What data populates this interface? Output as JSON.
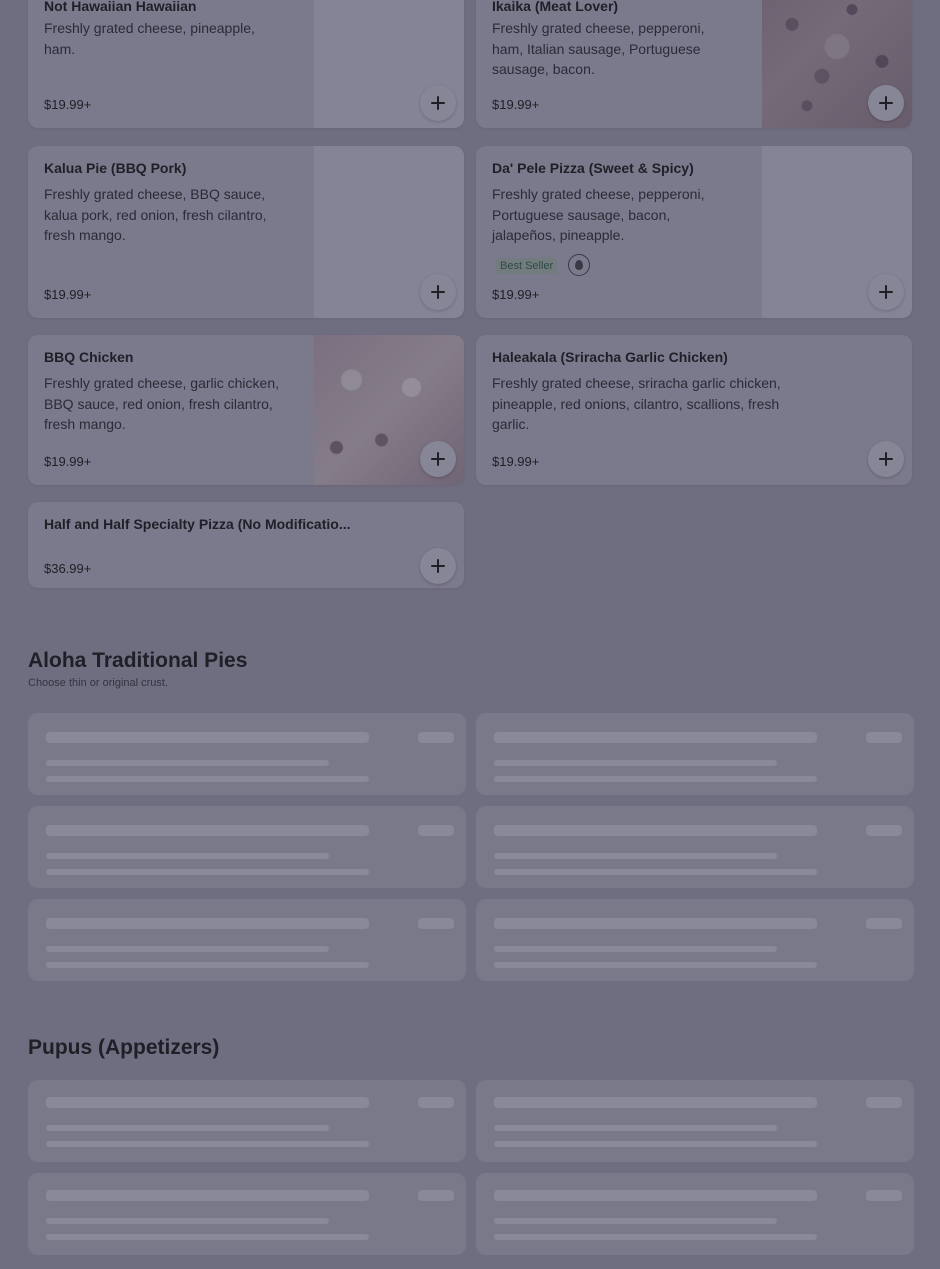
{
  "colors": {
    "overlay": "#6f6e80",
    "card": "#7b7a8c",
    "text": "#1f1f27",
    "badge_text": "#2f4a44"
  },
  "items": [
    {
      "name": "Not Hawaiian Hawaiian",
      "desc": "Freshly grated cheese, pineapple, ham.",
      "price": "$19.99+"
    },
    {
      "name": "Ikaika (Meat Lover)",
      "desc": "Freshly grated cheese, pepperoni, ham, Italian sausage, Portuguese sausage, bacon.",
      "price": "$19.99+"
    },
    {
      "name": "Kalua Pie (BBQ Pork)",
      "desc": "Freshly grated cheese, BBQ sauce, kalua pork, red onion, fresh cilantro, fresh mango.",
      "price": "$19.99+"
    },
    {
      "name": "Da' Pele Pizza (Sweet & Spicy)",
      "desc": "Freshly grated cheese, pepperoni, Portuguese sausage, bacon, jalapeños, pineapple.",
      "price": "$19.99+",
      "badge": "Best Seller",
      "badge_icon": "fire-icon"
    },
    {
      "name": "BBQ Chicken",
      "desc": "Freshly grated cheese, garlic chicken, BBQ sauce, red onion, fresh cilantro, fresh mango.",
      "price": "$19.99+"
    },
    {
      "name": "Haleakala (Sriracha Garlic Chicken)",
      "desc": "Freshly grated cheese, sriracha garlic chicken, pineapple, red onions, cilantro, scallions, fresh garlic.",
      "price": "$19.99+"
    },
    {
      "name": "Half and Half Specialty Pizza (No Modificatio...",
      "price": "$36.99+"
    }
  ],
  "sections": {
    "traditional": {
      "title": "Aloha Traditional Pies",
      "subtitle": "Choose thin or original crust."
    },
    "pupus": {
      "title": "Pupus (Appetizers)"
    }
  },
  "icons": {
    "add": "plus-icon",
    "best_seller": "fire-icon"
  }
}
